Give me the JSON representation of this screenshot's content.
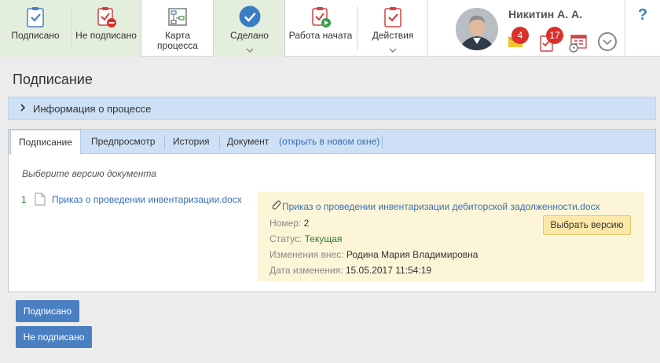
{
  "toolbar": {
    "signed_label": "Подписано",
    "not_signed_label": "Не подписано",
    "process_map_label_1": "Карта",
    "process_map_label_2": "процесса",
    "done_label": "Сделано",
    "work_started_label": "Работа начата",
    "actions_label": "Действия",
    "help_label": "?"
  },
  "user": {
    "name": "Никитин А. А.",
    "messages_count": "4",
    "tasks_count": "17"
  },
  "page": {
    "title": "Подписание",
    "process_info_label": "Информация о процессе"
  },
  "tabs": [
    {
      "label": "Подписание",
      "active": true
    },
    {
      "label": "Предпросмотр"
    },
    {
      "label": "История"
    },
    {
      "label": "Документ"
    }
  ],
  "open_new_window_label": "(открыть в новом окне)",
  "versions": {
    "hint": "Выберите версию документа",
    "list": [
      {
        "number": "1",
        "name": "Приказ о проведении инвентаризации.docx"
      }
    ]
  },
  "details": {
    "title": "Приказ о проведении инвентаризации дебиторской задолженности.docx",
    "number_label": "Номер:",
    "number_value": "2",
    "status_label": "Статус:",
    "status_value": "Текущая",
    "changed_by_label": "Изменения внес:",
    "changed_by_value": "Родина Мария Владимировна",
    "changed_date_label": "Дата изменения:",
    "changed_date_value": "15.05.2017 11:54:19",
    "choose_version_label": "Выбрать версию"
  },
  "bottom_buttons": {
    "signed_label": "Подписано",
    "not_signed_label": "Не подписано"
  },
  "colors": {
    "accent_blue": "#4a7fc2",
    "link_blue": "#3a6fb5",
    "green_group": "#e4eedd",
    "badge_red": "#d9312a",
    "tab_bar": "#cde0f5",
    "detail_bg": "#fdf5d8"
  },
  "icons": {
    "signed": "clipboard-check-icon",
    "not_signed": "clipboard-minus-icon",
    "process_map": "flowchart-icon",
    "done": "check-circle-icon",
    "work_started": "clipboard-play-icon",
    "actions": "clipboard-check-icon",
    "messages": "envelope-icon",
    "tasks": "task-checklist-icon",
    "calendar": "calendar-clock-icon",
    "expand": "chevron-down-circle-icon",
    "file": "file-icon",
    "attachment": "paperclip-icon"
  }
}
